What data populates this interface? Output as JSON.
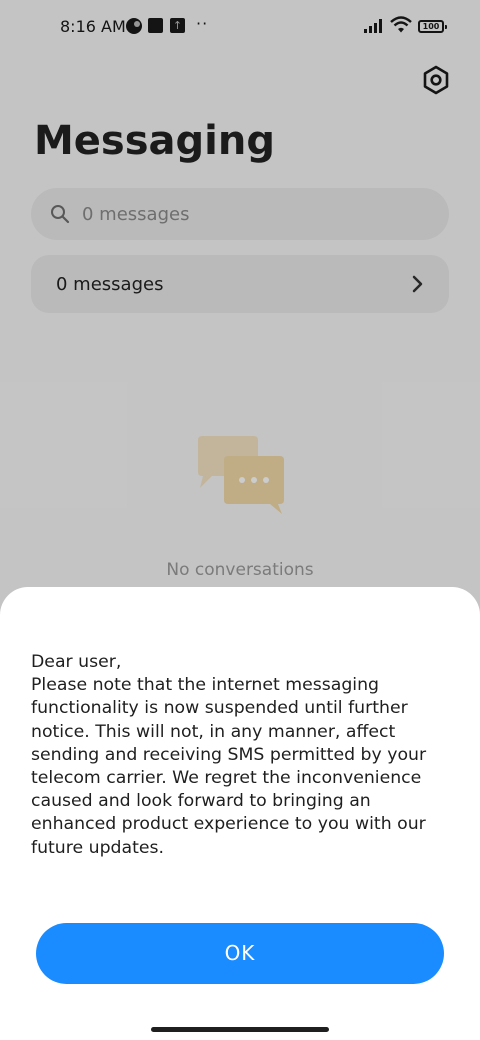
{
  "status_bar": {
    "time": "8:16 AM",
    "battery": "100",
    "dots": "··",
    "icons": [
      "data-saver-icon",
      "square-icon",
      "upload-icon",
      "signal-icon",
      "wifi-icon",
      "battery-icon"
    ]
  },
  "header": {
    "title": "Messaging",
    "settings_icon": "settings-hexagon-icon"
  },
  "search": {
    "placeholder": "0 messages",
    "icon": "search-icon"
  },
  "messages_row": {
    "label": "0 messages",
    "icon": "chevron-right-icon"
  },
  "empty_state": {
    "text": "No conversations",
    "icon": "chat-bubbles-icon"
  },
  "dialog": {
    "message": "Dear user,\nPlease note that the internet messaging functionality is now suspended until further notice. This will not, in any manner, affect sending and receiving SMS permitted by your telecom carrier. We regret the inconvenience caused and look forward to bringing an enhanced product experience to you with our future updates.",
    "ok_label": "OK"
  },
  "colors": {
    "accent": "#1a8cff",
    "background": "#f6f6f6",
    "dialog_background": "#ffffff"
  }
}
